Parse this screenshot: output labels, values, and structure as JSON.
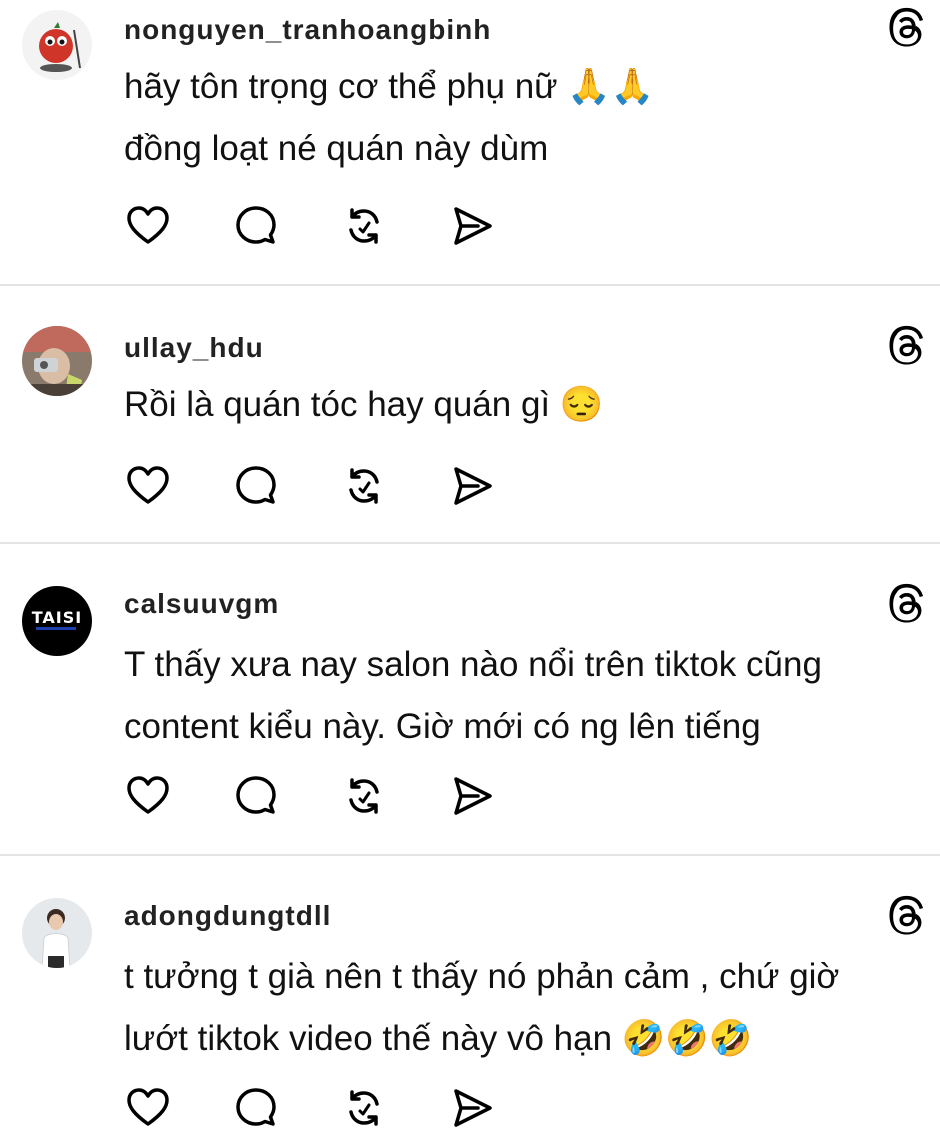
{
  "comments": [
    {
      "username": "nonguyen_tranhoangbinh",
      "timestamp": "",
      "lines": [
        "hãy tôn trọng cơ thể phụ nữ 🙏🙏",
        "đồng loạt né quán này dùm"
      ]
    },
    {
      "username": "ullay_hdu",
      "timestamp": "",
      "lines": [
        "Rồi là quán tóc hay quán gì 😔"
      ]
    },
    {
      "username": "calsuuvgm",
      "timestamp": "",
      "lines": [
        "T thấy xưa nay salon nào nổi trên tiktok cũng",
        "content kiểu này. Giờ mới có ng lên tiếng"
      ]
    },
    {
      "username": "adongdungtdll",
      "timestamp": "",
      "lines": [
        "t tưởng t già nên t thấy nó phản cảm , chứ giờ",
        "lướt tiktok video thế này vô hạn 🤣🤣🤣"
      ]
    }
  ],
  "avatars": [
    {
      "label": "",
      "colors": [
        "#c0392b",
        "#e74c3c"
      ]
    },
    {
      "label": "",
      "colors": [
        "#6b5a4e",
        "#b9a89a"
      ]
    },
    {
      "label": "TAISI",
      "colors": [
        "#000000",
        "#ffffff"
      ]
    },
    {
      "label": "",
      "colors": [
        "#e8ebee",
        "#ffffff"
      ]
    }
  ],
  "icons": {
    "like": "heart-icon",
    "reply": "comment-icon",
    "repost": "repost-icon",
    "share": "send-icon",
    "threads": "threads-logo-icon"
  }
}
